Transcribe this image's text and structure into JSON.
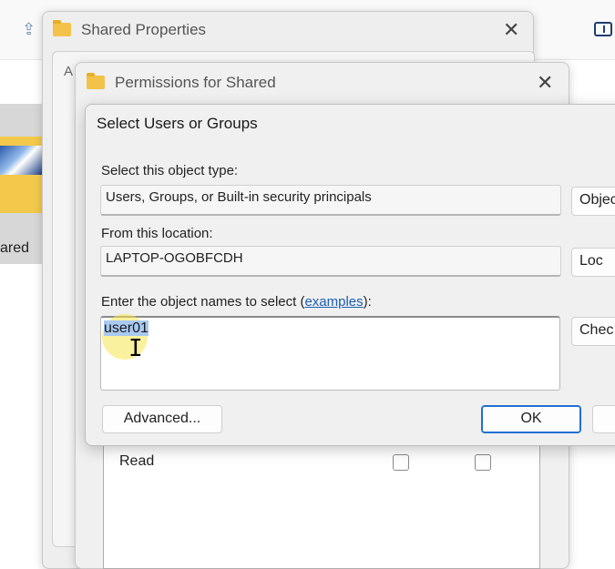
{
  "shared_dialog": {
    "title": "Shared Properties",
    "inner_tab_fragment": "A"
  },
  "permissions_dialog": {
    "title": "Permissions for Shared",
    "read_label": "Read"
  },
  "explorer": {
    "thumbnail_label": "ared"
  },
  "select_dialog": {
    "title": "Select Users or Groups",
    "object_type_label": "Select this object type:",
    "object_type_value": "Users, Groups, or Built-in security principals",
    "object_types_button": "Objec",
    "location_label": "From this location:",
    "location_value": "LAPTOP-OGOBFCDH",
    "locations_button": "Loc",
    "names_label_prefix": "Enter the object names to select (",
    "names_label_link": "examples",
    "names_label_suffix": "):",
    "names_value": "user01",
    "check_names_button": "Chec",
    "advanced_button": "Advanced...",
    "ok_button": "OK"
  }
}
